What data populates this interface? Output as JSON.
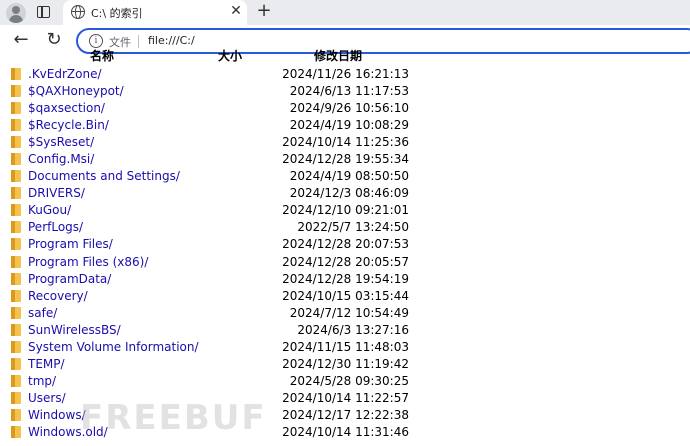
{
  "tab": {
    "title": "C:\\ 的索引"
  },
  "address": {
    "scheme_label": "文件",
    "url": "file:///C:/"
  },
  "columns": {
    "name": "名称",
    "size": "大小",
    "modified": "修改日期"
  },
  "entries": [
    {
      "name": ".KvEdrZone/",
      "modified": "2024/11/26 16:21:13"
    },
    {
      "name": "$QAXHoneypot/",
      "modified": "2024/6/13 11:17:53"
    },
    {
      "name": "$qaxsection/",
      "modified": "2024/9/26 10:56:10"
    },
    {
      "name": "$Recycle.Bin/",
      "modified": "2024/4/19 10:08:29"
    },
    {
      "name": "$SysReset/",
      "modified": "2024/10/14 11:25:36"
    },
    {
      "name": "Config.Msi/",
      "modified": "2024/12/28 19:55:34"
    },
    {
      "name": "Documents and Settings/",
      "modified": "2024/4/19 08:50:50"
    },
    {
      "name": "DRIVERS/",
      "modified": "2024/12/3 08:46:09"
    },
    {
      "name": "KuGou/",
      "modified": "2024/12/10 09:21:01"
    },
    {
      "name": "PerfLogs/",
      "modified": "2022/5/7 13:24:50"
    },
    {
      "name": "Program Files/",
      "modified": "2024/12/28 20:07:53"
    },
    {
      "name": "Program Files (x86)/",
      "modified": "2024/12/28 20:05:57"
    },
    {
      "name": "ProgramData/",
      "modified": "2024/12/28 19:54:19"
    },
    {
      "name": "Recovery/",
      "modified": "2024/10/15 03:15:44"
    },
    {
      "name": "safe/",
      "modified": "2024/7/12 10:54:49"
    },
    {
      "name": "SunWirelessBS/",
      "modified": "2024/6/3 13:27:16"
    },
    {
      "name": "System Volume Information/",
      "modified": "2024/11/15 11:48:03"
    },
    {
      "name": "TEMP/",
      "modified": "2024/12/30 11:19:42"
    },
    {
      "name": "tmp/",
      "modified": "2024/5/28 09:30:25"
    },
    {
      "name": "Users/",
      "modified": "2024/10/14 11:22:57"
    },
    {
      "name": "Windows/",
      "modified": "2024/12/17 12:22:38"
    },
    {
      "name": "Windows.old/",
      "modified": "2024/10/14 11:31:46"
    }
  ],
  "watermark": "FREEBUF",
  "icons": {
    "profile": "avatar-icon",
    "tabs": "tab-actions-icon",
    "site": "globe-icon",
    "close": "close-icon",
    "new_tab": "plus-icon",
    "back": "arrow-left-icon",
    "reload": "reload-icon",
    "info": "info-icon",
    "folder": "folder-icon"
  }
}
